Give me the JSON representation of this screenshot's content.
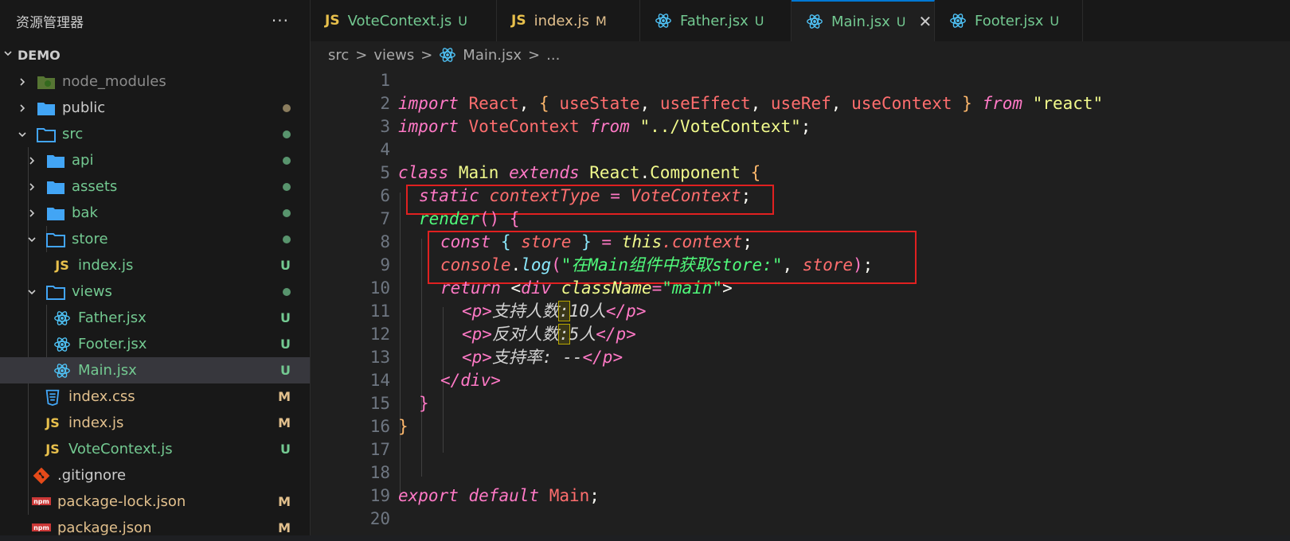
{
  "explorer": {
    "title": "资源管理器",
    "more": "···",
    "root": "DEMO",
    "items": [
      {
        "label": "node_modules",
        "status": "",
        "color": "#8b8b8b"
      },
      {
        "label": "public",
        "status": "dot",
        "dot": "#8b7d5e"
      },
      {
        "label": "src",
        "status": "dot",
        "dot": "#73c991"
      },
      {
        "label": "api",
        "status": "dot",
        "dot": "#73c991"
      },
      {
        "label": "assets",
        "status": "dot",
        "dot": "#73c991"
      },
      {
        "label": "bak",
        "status": "dot",
        "dot": "#73c991"
      },
      {
        "label": "store",
        "status": "dot",
        "dot": "#73c991"
      },
      {
        "label": "index.js",
        "status": "U"
      },
      {
        "label": "views",
        "status": "dot",
        "dot": "#73c991"
      },
      {
        "label": "Father.jsx",
        "status": "U"
      },
      {
        "label": "Footer.jsx",
        "status": "U"
      },
      {
        "label": "Main.jsx",
        "status": "U"
      },
      {
        "label": "index.css",
        "status": "M"
      },
      {
        "label": "index.js",
        "status": "M"
      },
      {
        "label": "VoteContext.js",
        "status": "U"
      },
      {
        "label": ".gitignore",
        "status": ""
      },
      {
        "label": "package-lock.json",
        "status": "M"
      },
      {
        "label": "package.json",
        "status": "M"
      }
    ]
  },
  "tabs": [
    {
      "label": "VoteContext.js",
      "status": "U",
      "icon": "js-icon"
    },
    {
      "label": "index.js",
      "status": "M",
      "icon": "js-icon"
    },
    {
      "label": "Father.jsx",
      "status": "U",
      "icon": "react-icon"
    },
    {
      "label": "Main.jsx",
      "status": "U",
      "icon": "react-icon",
      "active": true,
      "close": "✕"
    },
    {
      "label": "Footer.jsx",
      "status": "U",
      "icon": "react-icon"
    }
  ],
  "breadcrumb": {
    "src": "src",
    "views": "views",
    "file": "Main.jsx",
    "more": "..."
  },
  "colors": {
    "accent": "#0078d4",
    "highlight_box": "#e02020",
    "untracked": "#73c991",
    "modified": "#e2c08d"
  },
  "editor": {
    "line_numbers": [
      "1",
      "2",
      "3",
      "4",
      "5",
      "6",
      "7",
      "8",
      "9",
      "10",
      "11",
      "12",
      "13",
      "14",
      "15",
      "16",
      "17",
      "18",
      "19",
      "20"
    ],
    "l2": {
      "import": "import",
      "react": "React",
      "comma1": ",",
      "lb": "{",
      "useState": "useState",
      "useEffect": "useEffect",
      "useRef": "useRef",
      "useContext": "useContext",
      "rb": "}",
      "from": "from",
      "src": "\"react\""
    },
    "l3": {
      "import": "import",
      "vc": "VoteContext",
      "from": "from",
      "src": "\"../VoteContext\"",
      "semi": ";"
    },
    "l5": {
      "class": "class",
      "main": "Main",
      "extends": "extends",
      "react": "React",
      "dot": ".",
      "component": "Component",
      "brace": "{"
    },
    "l6": {
      "static": "static",
      "ct": "contextType",
      "eq": "=",
      "vc": "VoteContext",
      "semi": ";"
    },
    "l7": {
      "render": "render",
      "paren": "()",
      "brace": "{"
    },
    "l8": {
      "const": "const",
      "lb": "{",
      "store": "store",
      "rb": "}",
      "eq": "=",
      "this": "this",
      "ctx": ".context",
      "semi": ";"
    },
    "l9": {
      "console": "console",
      "dot": ".",
      "log": "log",
      "lp": "(",
      "str": "\"在Main组件中获取store:\"",
      "comma": ",",
      "store": "store",
      "rp": ")",
      "semi": ";"
    },
    "l10": {
      "return": "return",
      "lt": "<",
      "div": "div",
      "attr": "className",
      "eq": "=",
      "val": "\"main\"",
      "gt": ">"
    },
    "l11": {
      "open": "<p>",
      "text1": "支持人数",
      "colon": ":",
      "text2": "10人",
      "close": "</p>"
    },
    "l12": {
      "open": "<p>",
      "text1": "反对人数",
      "colon": ":",
      "text2": "5人",
      "close": "</p>"
    },
    "l13": {
      "open": "<p>",
      "text": "支持率: --",
      "close": "</p>"
    },
    "l14": {
      "close": "</div>"
    },
    "l15": {
      "brace": "}"
    },
    "l16": {
      "brace": "}"
    },
    "l19": {
      "export": "export",
      "default": "default",
      "main": "Main",
      "semi": ";"
    }
  }
}
